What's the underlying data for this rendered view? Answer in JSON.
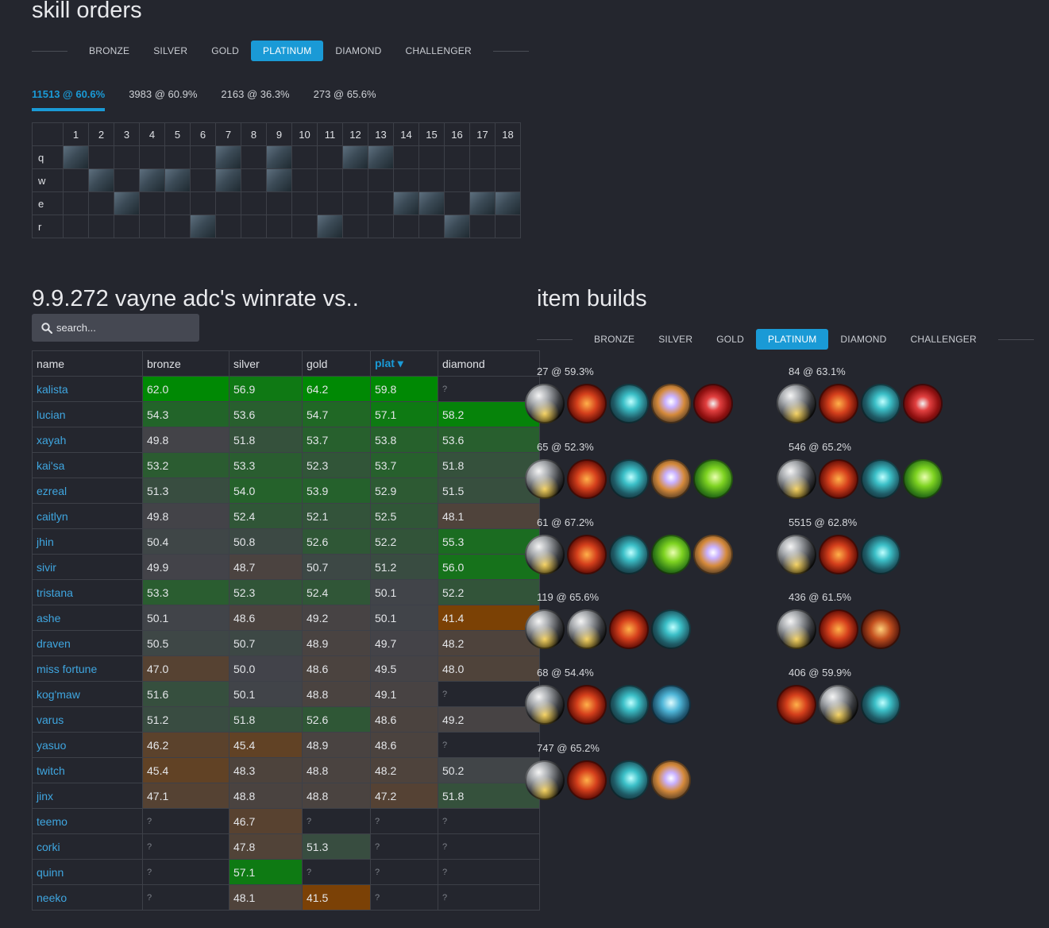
{
  "skill_orders": {
    "title": "skill orders",
    "tiers": [
      "BRONZE",
      "SILVER",
      "GOLD",
      "PLATINUM",
      "DIAMOND",
      "CHALLENGER"
    ],
    "active_tier": "PLATINUM",
    "tabs": [
      "11513 @ 60.6%",
      "3983 @ 60.9%",
      "2163 @ 36.3%",
      "273 @ 65.6%"
    ],
    "active_tab": 0,
    "levels": [
      "1",
      "2",
      "3",
      "4",
      "5",
      "6",
      "7",
      "8",
      "9",
      "10",
      "11",
      "12",
      "13",
      "14",
      "15",
      "16",
      "17",
      "18"
    ],
    "rows": [
      {
        "key": "q",
        "levels": [
          1,
          7,
          9,
          12,
          13
        ]
      },
      {
        "key": "w",
        "levels": [
          2,
          4,
          5,
          7,
          9
        ]
      },
      {
        "key": "e",
        "levels": [
          3,
          14,
          15,
          17,
          18
        ]
      },
      {
        "key": "r",
        "levels": [
          6,
          11,
          16
        ]
      }
    ]
  },
  "winrate": {
    "title": "9.9.272 vayne adc's winrate vs..",
    "search_placeholder": "search...",
    "columns": [
      "name",
      "bronze",
      "silver",
      "gold",
      "plat",
      "diamond"
    ],
    "sorted_column": "plat",
    "rows": [
      {
        "name": "kalista",
        "vals": [
          "62.0",
          "56.9",
          "64.2",
          "59.8",
          "?"
        ]
      },
      {
        "name": "lucian",
        "vals": [
          "54.3",
          "53.6",
          "54.7",
          "57.1",
          "58.2"
        ]
      },
      {
        "name": "xayah",
        "vals": [
          "49.8",
          "51.8",
          "53.7",
          "53.8",
          "53.6"
        ]
      },
      {
        "name": "kai'sa",
        "vals": [
          "53.2",
          "53.3",
          "52.3",
          "53.7",
          "51.8"
        ]
      },
      {
        "name": "ezreal",
        "vals": [
          "51.3",
          "54.0",
          "53.9",
          "52.9",
          "51.5"
        ]
      },
      {
        "name": "caitlyn",
        "vals": [
          "49.8",
          "52.4",
          "52.1",
          "52.5",
          "48.1"
        ]
      },
      {
        "name": "jhin",
        "vals": [
          "50.4",
          "50.8",
          "52.6",
          "52.2",
          "55.3"
        ]
      },
      {
        "name": "sivir",
        "vals": [
          "49.9",
          "48.7",
          "50.7",
          "51.2",
          "56.0"
        ]
      },
      {
        "name": "tristana",
        "vals": [
          "53.3",
          "52.3",
          "52.4",
          "50.1",
          "52.2"
        ]
      },
      {
        "name": "ashe",
        "vals": [
          "50.1",
          "48.6",
          "49.2",
          "50.1",
          "41.4"
        ]
      },
      {
        "name": "draven",
        "vals": [
          "50.5",
          "50.7",
          "48.9",
          "49.7",
          "48.2"
        ]
      },
      {
        "name": "miss fortune",
        "vals": [
          "47.0",
          "50.0",
          "48.6",
          "49.5",
          "48.0"
        ]
      },
      {
        "name": "kog'maw",
        "vals": [
          "51.6",
          "50.1",
          "48.8",
          "49.1",
          "?"
        ]
      },
      {
        "name": "varus",
        "vals": [
          "51.2",
          "51.8",
          "52.6",
          "48.6",
          "49.2"
        ]
      },
      {
        "name": "yasuo",
        "vals": [
          "46.2",
          "45.4",
          "48.9",
          "48.6",
          "?"
        ]
      },
      {
        "name": "twitch",
        "vals": [
          "45.4",
          "48.3",
          "48.8",
          "48.2",
          "50.2"
        ]
      },
      {
        "name": "jinx",
        "vals": [
          "47.1",
          "48.8",
          "48.8",
          "47.2",
          "51.8"
        ]
      },
      {
        "name": "teemo",
        "vals": [
          "?",
          "46.7",
          "?",
          "?",
          "?"
        ]
      },
      {
        "name": "corki",
        "vals": [
          "?",
          "47.8",
          "51.3",
          "?",
          "?"
        ]
      },
      {
        "name": "quinn",
        "vals": [
          "?",
          "57.1",
          "?",
          "?",
          "?"
        ]
      },
      {
        "name": "neeko",
        "vals": [
          "?",
          "48.1",
          "41.5",
          "?",
          "?"
        ]
      }
    ]
  },
  "item_builds": {
    "title": "item builds",
    "tiers": [
      "BRONZE",
      "SILVER",
      "GOLD",
      "PLATINUM",
      "DIAMOND",
      "CHALLENGER"
    ],
    "active_tier": "PLATINUM",
    "builds": [
      {
        "label": "27 @ 59.3%",
        "items": [
          "boots",
          "blade",
          "bow",
          "ie",
          "bork"
        ]
      },
      {
        "label": "84 @ 63.1%",
        "items": [
          "boots",
          "blade",
          "bow",
          "bork"
        ]
      },
      {
        "label": "65 @ 52.3%",
        "items": [
          "boots",
          "blade",
          "bow",
          "ie",
          "rr"
        ]
      },
      {
        "label": "546 @ 65.2%",
        "items": [
          "boots",
          "blade",
          "bow",
          "rr"
        ]
      },
      {
        "label": "61 @ 67.2%",
        "items": [
          "boots",
          "blade",
          "bow",
          "rr",
          "ie"
        ]
      },
      {
        "label": "5515 @ 62.8%",
        "items": [
          "boots",
          "blade",
          "bow"
        ]
      },
      {
        "label": "119 @ 65.6%",
        "items": [
          "boots",
          "boots",
          "blade",
          "bow"
        ]
      },
      {
        "label": "436 @ 61.5%",
        "items": [
          "boots",
          "blade",
          "gun"
        ]
      },
      {
        "label": "68 @ 54.4%",
        "items": [
          "boots",
          "blade",
          "bow",
          "cleaver"
        ]
      },
      {
        "label": "406 @ 59.9%",
        "items": [
          "blade",
          "boots",
          "bow"
        ]
      },
      {
        "label": "747 @ 65.2%",
        "items": [
          "boots",
          "blade",
          "bow",
          "ie"
        ]
      }
    ]
  },
  "colors": {
    "accent": "#1a9ad6",
    "link": "#3fa6e0",
    "background": "#24262e"
  }
}
